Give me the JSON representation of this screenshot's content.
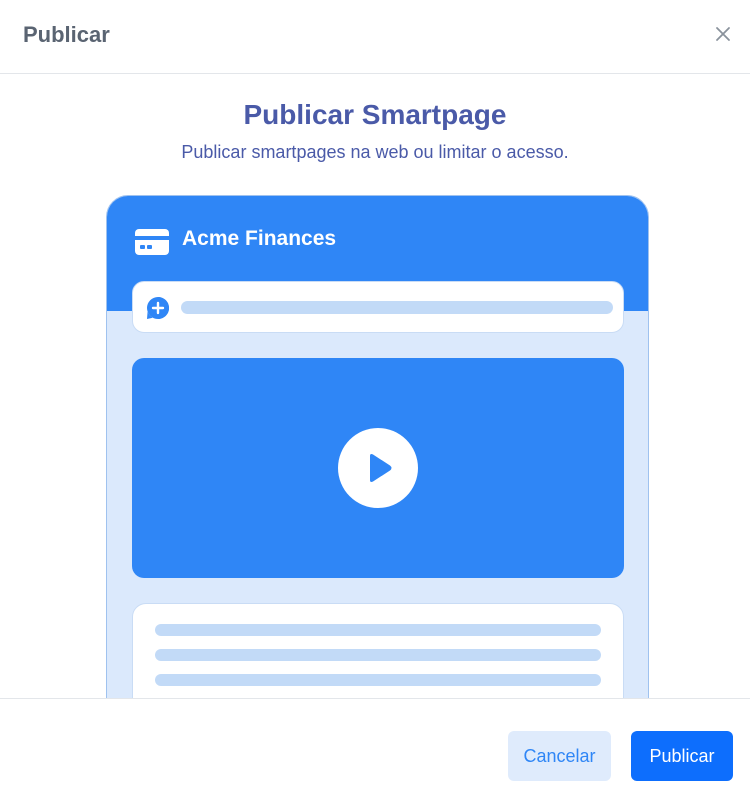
{
  "header": {
    "title": "Publicar"
  },
  "hero": {
    "title": "Publicar Smartpage",
    "subtitle": "Publicar smartpages na web ou limitar o acesso."
  },
  "preview": {
    "app_name": "Acme Finances",
    "icons": {
      "app": "credit-card-icon",
      "add": "plus-circle-icon",
      "media": "play-icon"
    }
  },
  "footer": {
    "cancel_label": "Cancelar",
    "publish_label": "Publicar"
  },
  "colors": {
    "primary": "#0d6efd",
    "accent": "#2f86f6",
    "heading": "#4a5aa8",
    "preview_background": "#dbe9fc",
    "placeholder_line": "#c2daf7"
  }
}
